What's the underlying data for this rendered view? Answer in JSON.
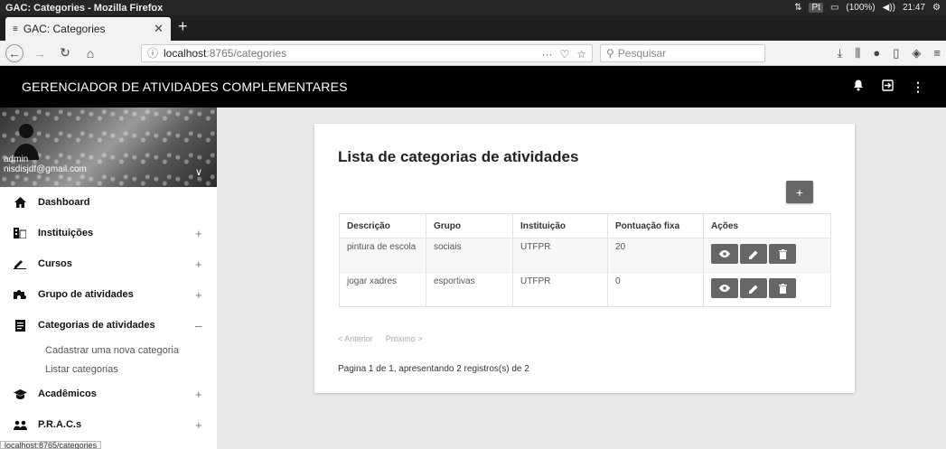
{
  "os": {
    "window_title": "GAC: Categories - Mozilla Firefox",
    "lang": "Pt",
    "battery": "(100%)",
    "clock": "21:47"
  },
  "browser": {
    "tab_title": "GAC: Categories",
    "url_host": "localhost",
    "url_path": ":8765/categories",
    "search_placeholder": "Pesquisar",
    "status_url": "localhost:8765/categories"
  },
  "app": {
    "title": "GERENCIADOR DE ATIVIDADES COMPLEMENTARES"
  },
  "profile": {
    "username": "admin",
    "email": "nisdisjdf@gmail.com"
  },
  "sidebar": {
    "items": [
      {
        "label": "Dashboard",
        "icon": "home-icon",
        "toggle": ""
      },
      {
        "label": "Instituições",
        "icon": "building-icon",
        "toggle": "+"
      },
      {
        "label": "Cursos",
        "icon": "pencil-icon",
        "toggle": "+"
      },
      {
        "label": "Grupo de atividades",
        "icon": "puzzle-icon",
        "toggle": "+"
      },
      {
        "label": "Categorias de atividades",
        "icon": "document-icon",
        "toggle": "–"
      },
      {
        "label": "Acadêmicos",
        "icon": "graduation-cap-icon",
        "toggle": "+"
      },
      {
        "label": "P.R.A.C.s",
        "icon": "people-icon",
        "toggle": "+"
      }
    ],
    "submenu": [
      "Cadastrar uma nova categoria",
      "Listar categorias"
    ]
  },
  "main": {
    "title": "Lista de categorias de atividades",
    "add_label": "+",
    "columns": [
      "Descrição",
      "Grupo",
      "Instituição",
      "Pontuação fixa",
      "Ações"
    ],
    "rows": [
      {
        "descricao": "pintura de escola",
        "grupo": "sociais",
        "instituicao": "UTFPR",
        "pontuacao": "20"
      },
      {
        "descricao": "jogar xadres",
        "grupo": "esportivas",
        "instituicao": "UTFPR",
        "pontuacao": "0"
      }
    ],
    "pager": {
      "prev": "< Anterior",
      "next": "Próximo >"
    },
    "summary": "Pagina 1 de 1, apresentando 2 registros(s) de 2"
  }
}
